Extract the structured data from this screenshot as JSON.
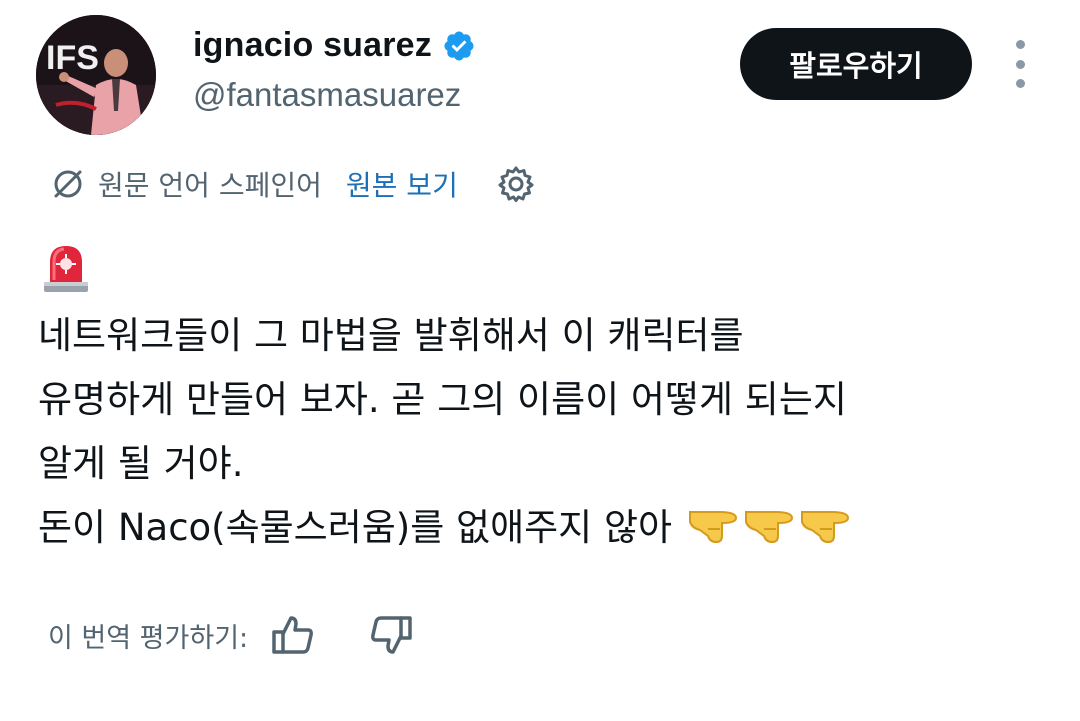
{
  "profile": {
    "name": "ignacio suarez",
    "handle": "@fantasmasuarez",
    "avatar_text": "IFS",
    "verified_icon": "verified-badge-icon",
    "verified_color": "#1d9bf0"
  },
  "follow_button": {
    "label": "팔로우하기"
  },
  "more_menu": {
    "icon": "more-vertical-icon"
  },
  "translation": {
    "source_label": "원문 언어 스페인어",
    "show_original_label": "원본 보기",
    "link_color": "#1d70b8",
    "settings_icon": "gear-icon"
  },
  "tweet": {
    "lead_emoji": "rotating-light-icon",
    "lines": [
      "네트워크들이 그 마법을 발휘해서 이 캐릭터를",
      "유명하게 만들어 보자. 곧 그의 이름이 어떻게 되는지",
      "알게 될 거야.",
      "돈이 Naco(속물스러움)를 없애주지 않아"
    ],
    "trailing_emoji": [
      "backhand-index-pointing-right-icon",
      "backhand-index-pointing-right-icon",
      "backhand-index-pointing-right-icon"
    ]
  },
  "rating": {
    "label": "이 번역 평가하기:",
    "up_icon": "thumbs-up-icon",
    "down_icon": "thumbs-down-icon"
  }
}
